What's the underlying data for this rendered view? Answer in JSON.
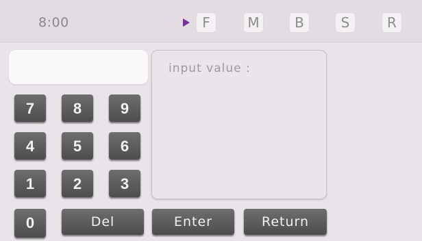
{
  "status_bar": {
    "time": "8:00",
    "modes": [
      "F",
      "M",
      "B",
      "S",
      "R"
    ]
  },
  "input": {
    "display_value": "",
    "prompt": "input value :"
  },
  "keypad": {
    "keys": [
      "7",
      "8",
      "9",
      "4",
      "5",
      "6",
      "1",
      "2",
      "3",
      "0"
    ],
    "del_label": "Del",
    "enter_label": "Enter",
    "return_label": "Return"
  },
  "colors": {
    "background": "#e9e4ea",
    "key": "#5a5a5a",
    "key_text": "#f2f2f2",
    "active_mode_indicator": "#7a2e9c"
  }
}
